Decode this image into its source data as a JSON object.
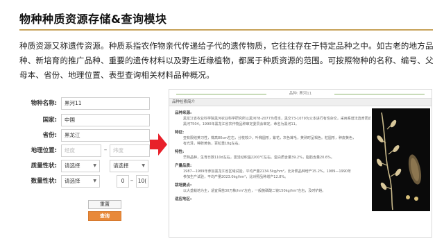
{
  "title": "物种种质资源存储&查询模块",
  "intro": "种质资源又称遗传资源。种质系指农作物亲代传递给子代的遗传物质，它往往存在于特定品种之中。如古老的地方品种、新培育的推广品种、重要的遗传材料以及野生近缘植物，都属于种质资源的范围。可按照物种的名称、编号、父母本、省份、地理位置、表型查询相关材料品种概况。",
  "form": {
    "fields": [
      {
        "label": "物种名称:",
        "value": "黑河11"
      },
      {
        "label": "国家:",
        "value": "中国"
      },
      {
        "label": "省份:",
        "value": "黑龙江"
      }
    ],
    "geo": {
      "label": "地理位置:",
      "lon_placeholder": "经度",
      "lat_placeholder": "纬度"
    },
    "quality": {
      "label": "质量性状:",
      "select1": "请选择",
      "select2": "请选择"
    },
    "quantity": {
      "label": "数量性状:",
      "select1": "请选择",
      "min": "0",
      "max": "10("
    },
    "reset_label": "重置",
    "query_label": "查询"
  },
  "detail": {
    "top_caption": "品种: 黑河11",
    "header": "品种检索简介",
    "sections": [
      {
        "title": "品种来源:",
        "lines": [
          "黑龙江省农业科学院黑河农业科学研究所以黑河78-2077为母本，黑交73-1079为父本进行有性杂交，采用系谱法选育而成。原品系号",
          "黑河7504。1990年黑龙江省农作物品种审定委员会审定，命名为黑河11。"
        ]
      },
      {
        "title": "特征:",
        "lines": [
          "亚有限结荚习性，株高80cm左右，分枝较少，叶椭圆形，紫花，灰色茸毛，荚熟时呈褐色。粒圆形，种皮黄色，",
          "有光泽，种脐黄色，百粒重18g左右。"
        ]
      },
      {
        "title": "特性:",
        "lines": [
          "早熟品种，生育日数110d左右，需活动积温2200℃左右。蛋白质含量39.2%，脂肪含量20.6%。"
        ]
      },
      {
        "title": "产量品质:",
        "lines": [
          "1987—1989年参加黑龙江省区域试验，平均产量2134.5kg/hm²，比对照品种增产15.2%。1989—1990年",
          "参加生产试验，平均产量2023.0kg/hm²，比对照品种增产12.8%。"
        ]
      },
      {
        "title": "栽培要点:",
        "lines": [
          "以大垄栽培为主，适宜保苗30万株/hm²左右，一般施磷酸二铵150kg/hm²左右，及时铲趟。"
        ]
      },
      {
        "title": "适应地区:",
        "lines": []
      }
    ]
  },
  "colors": {
    "accent": "#c7a35a",
    "query_button": "#e8893a",
    "arrow": "#e8202a"
  }
}
